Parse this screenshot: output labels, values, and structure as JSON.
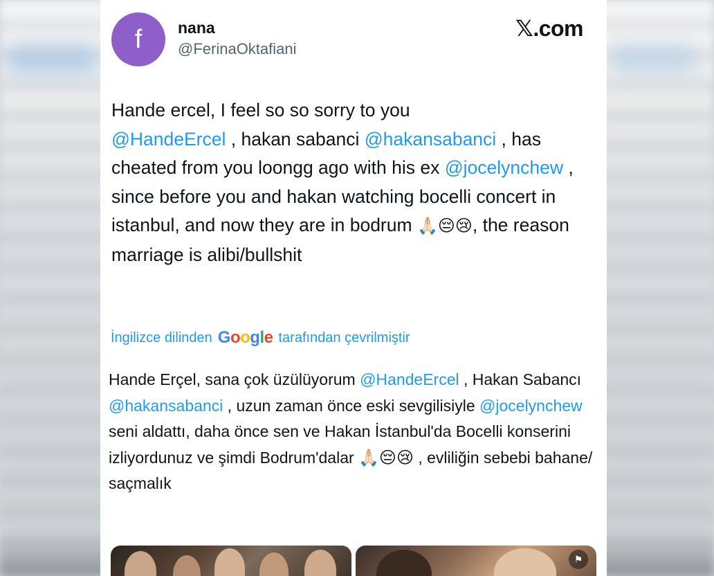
{
  "author": {
    "avatar_letter": "f",
    "name": "nana",
    "handle": "@FerinaOktafiani"
  },
  "brand": {
    "label": "𝕏.com"
  },
  "tweet": {
    "p1": "Hande ercel, I feel so so sorry to you",
    "m1": "@HandeErcel",
    "p2": " , hakan sabanci ",
    "m2": "@hakansabanci",
    "p3": " , has cheated from you loongg ago with his ex",
    "m3": "@jocelynchew",
    "p4": " , since before you and hakan watching bocelli concert in istanbul, and now they are in bodrum ",
    "emojis": "🙏🏻😔😢",
    "p5": ", the reason marriage is alibi/bullshit"
  },
  "translation_notice": {
    "prefix": "İngilizce dilinden",
    "google": [
      "G",
      "o",
      "o",
      "g",
      "l",
      "e"
    ],
    "suffix": "tarafından çevrilmiştir"
  },
  "translation": {
    "p1": "Hande Erçel, sana çok üzülüyorum ",
    "m1": "@HandeErcel",
    "p2": " , Hakan Sabancı ",
    "m2": "@hakansabanci",
    "p3": " , uzun zaman önce eski sevgilisiyle ",
    "m3": "@jocelynchew",
    "p4": " seni aldattı, daha önce sen ve Hakan İstanbul'da Bocelli konserini izliyordunuz ve şimdi Bodrum'dalar ",
    "emojis": "🙏🏻😔😢",
    "p5": " , evliliğin sebebi bahane/ saçmalık"
  },
  "colors": {
    "mention": "#1d9bf0",
    "avatar": "#8e5fc8",
    "text": "#0f1419",
    "secondary": "#536471"
  },
  "media": {
    "flag_icon": "flag-icon"
  }
}
